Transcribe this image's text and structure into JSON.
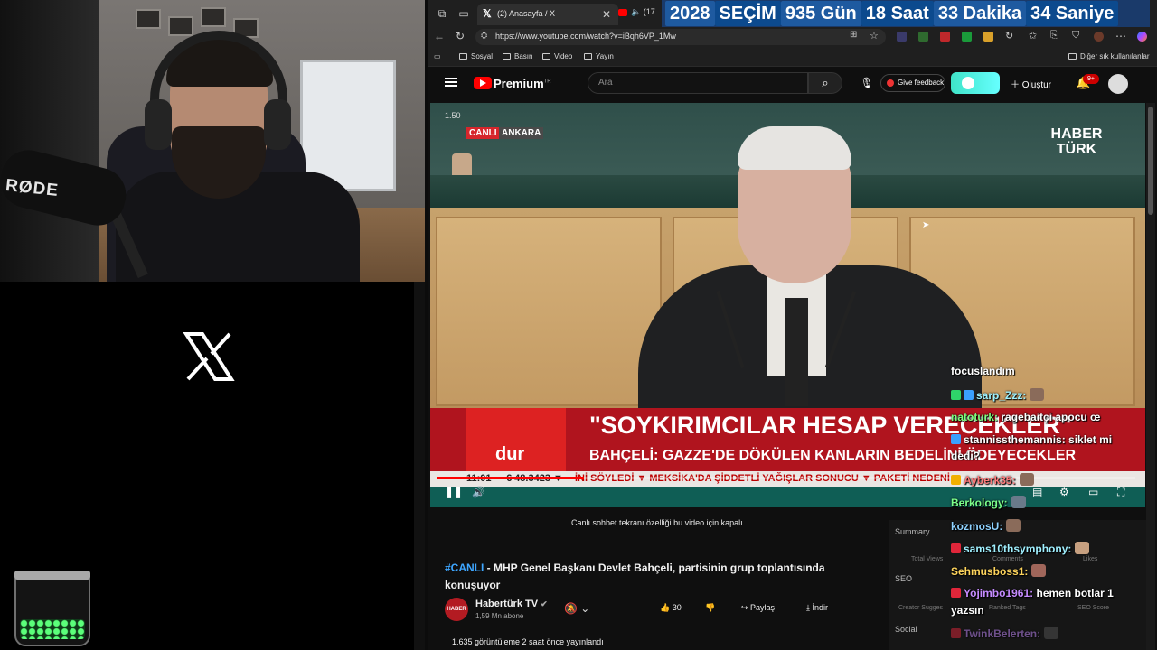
{
  "countdown": {
    "year": "2028",
    "election": "SEÇİM",
    "days": "935 Gün",
    "hours": "18 Saat",
    "minutes": "33 Dakika",
    "seconds": "34 Saniye"
  },
  "browser": {
    "tabs": [
      {
        "label": "(2) Anasayfa / X",
        "icon": "x-logo-icon"
      },
      {
        "label": "(17",
        "icon": "youtube-icon"
      }
    ],
    "url": "https://www.youtube.com/watch?v=iBqh6VP_1Mw",
    "bookmarks": [
      "Sosyal",
      "Basın",
      "Video",
      "Yayın"
    ],
    "other_bookmarks": "Diğer sık kullanılanlar"
  },
  "webcam": {
    "mic_brand": "RØDE"
  },
  "youtube": {
    "logo_text": "Premium",
    "logo_sup": "TR",
    "search_placeholder": "Ara",
    "feedback_label": "Give feedback",
    "create_label": "Oluştur",
    "notif_badge": "9+"
  },
  "video": {
    "time_tag": "1.50",
    "live_badge": "CANLI",
    "live_location": "ANKARA",
    "channel_logo": "HABER TÜRK",
    "headline_main": "\"SOYKIRIMCILAR HESAP VERECEKLER\"",
    "headline_sub": "BAHÇELİ: GAZZE'DE DÖKÜLEN KANLARIN BEDELİNİ ÖDEYECEKLER",
    "lower_logo": "dur",
    "ticker_time": "11:01",
    "ticker_currency": "€ 48.3423 ▼",
    "ticker_news": "İNİ SÖYLEDİ   ▼   MEKSİKA'DA ŞİDDETLİ YAĞIŞLAR SONUCU   ▼   PAKETİ NEDENİ",
    "progress_fraction": 0.21
  },
  "below": {
    "chat_off": "Canlı sohbet tekranı özelliği bu video için kapalı.",
    "title_tag": "#CANLI",
    "title_text": " - MHP Genel Başkanı Devlet Bahçeli, partisinin grup toplantısında konuşuyor",
    "channel_name": "Habertürk TV",
    "channel_subs": "1,59 Mn abone",
    "like_count": "30",
    "share_label": "Paylaş",
    "download_label": "İndir",
    "views": "1.635 görüntüleme  2 saat önce yayınlandı"
  },
  "side_panel": {
    "summary": "Summary",
    "seo": "SEO",
    "social": "Social",
    "total_views": "Total Views",
    "comments": "Comments",
    "likes": "Likes",
    "creator_suggest": "Creator Sugges",
    "ranked_tags": "Ranked Tags",
    "seo_score": "SEO Score"
  },
  "chat": [
    {
      "user": "focuslandım",
      "text": "",
      "color": "#ffffff"
    },
    {
      "user": "sarp_Zzz:",
      "text": "",
      "color": "#9ef2ff"
    },
    {
      "user": "natoturk:",
      "text": "ragebaitçi apocu œ",
      "color": "#7fff7f"
    },
    {
      "user": "stannissthemannis:",
      "text": "siklet mi",
      "color": "#ffffff"
    },
    {
      "user": "",
      "text": "dedi?",
      "color": "#ffffff"
    },
    {
      "user": "Ayberk35:",
      "text": "",
      "color": "#ff7a7a"
    },
    {
      "user": "Berkology:",
      "text": "",
      "color": "#7dff8a"
    },
    {
      "user": "kozmosU:",
      "text": "",
      "color": "#8fd2ff"
    },
    {
      "user": "sams10thsymphony:",
      "text": "",
      "color": "#a0f0ff"
    },
    {
      "user": "Sehmusboss1:",
      "text": "",
      "color": "#ffd55c"
    },
    {
      "user": "Yojimbo1961:",
      "text": "hemen botlar 1",
      "color": "#c58bff"
    },
    {
      "user": "",
      "text": "yazsın",
      "color": "#ffffff"
    },
    {
      "user": "TwinkBelerten:",
      "text": "",
      "color": "#c58bff"
    }
  ]
}
